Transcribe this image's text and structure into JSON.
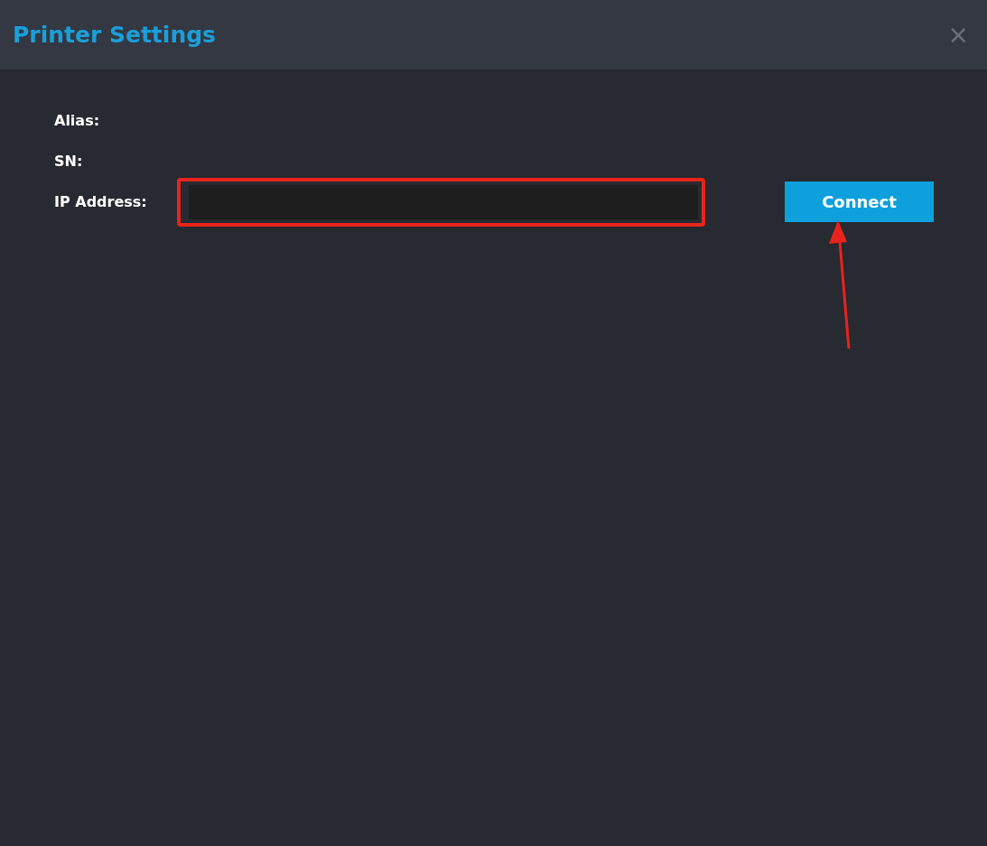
{
  "window": {
    "title": "Printer Settings",
    "close": "×"
  },
  "fields": [
    {
      "label": "Alias:",
      "kind": "text"
    },
    {
      "label": "SN:",
      "kind": "text"
    },
    {
      "label": "IP Address:",
      "kind": "input"
    }
  ],
  "connect_button": {
    "label": "Connect"
  }
}
